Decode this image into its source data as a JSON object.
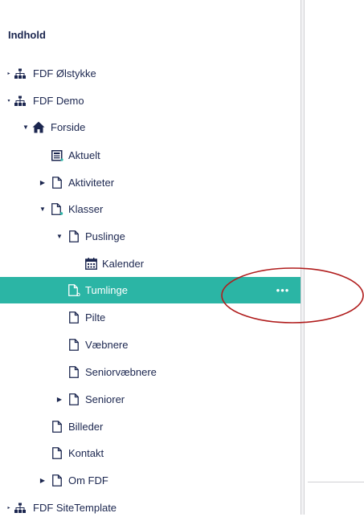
{
  "panel": {
    "title": "Indhold"
  },
  "tree": {
    "fdf_olstykke": "FDF Ølstykke",
    "fdf_demo": "FDF Demo",
    "forside": "Forside",
    "aktuelt": "Aktuelt",
    "aktiviteter": "Aktiviteter",
    "klasser": "Klasser",
    "puslinge": "Puslinge",
    "kalender": "Kalender",
    "tumlinge": "Tumlinge",
    "pilte": "Pilte",
    "vaebnere": "Væbnere",
    "seniorvaebnere": "Seniorvæbnere",
    "seniorer": "Seniorer",
    "billeder": "Billeder",
    "kontakt": "Kontakt",
    "om_fdf": "Om FDF",
    "fdf_sitetemplate": "FDF SiteTemplate"
  },
  "actions": {
    "more_glyph": "•••"
  },
  "colors": {
    "selected_bg": "#2bb5a5",
    "text": "#1b264f",
    "annotation": "#b01c1c"
  },
  "icons": {
    "site": "sitemap-icon",
    "home": "home-icon",
    "page": "document-icon",
    "news": "news-list-icon",
    "calendar": "calendar-icon"
  }
}
